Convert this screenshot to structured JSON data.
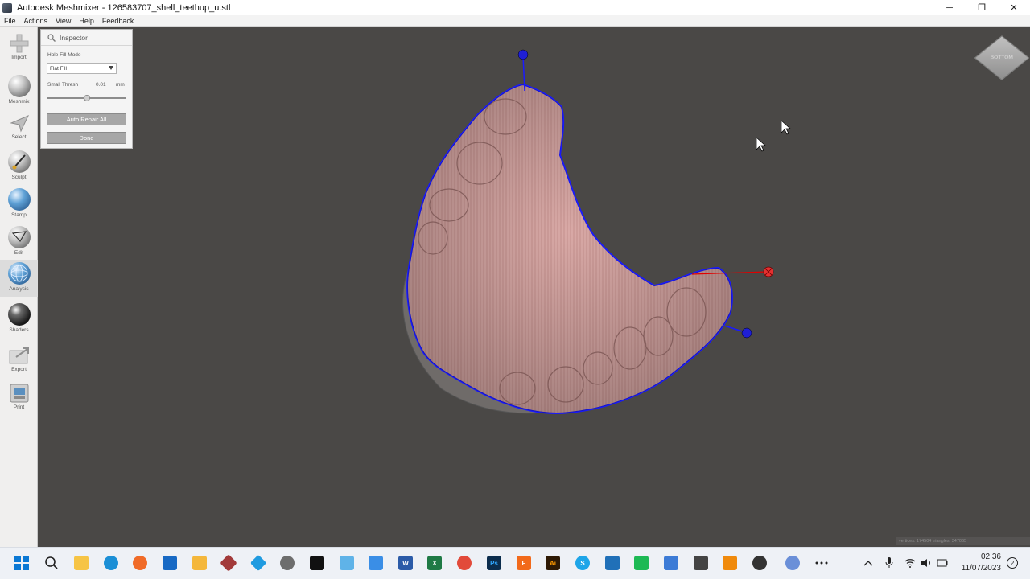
{
  "window": {
    "title": "Autodesk Meshmixer - 126583707_shell_teethup_u.stl",
    "minimize": "─",
    "maximize": "❐",
    "close": "✕"
  },
  "menu": [
    "File",
    "Actions",
    "View",
    "Help",
    "Feedback"
  ],
  "toolbar": {
    "items": [
      {
        "label": "Import",
        "icon": "plus-icon"
      },
      {
        "label": "Meshmix",
        "icon": "meshmix-sphere-icon"
      },
      {
        "label": "Select",
        "icon": "select-arrow-icon"
      },
      {
        "label": "Sculpt",
        "icon": "sculpt-brush-icon"
      },
      {
        "label": "Stamp",
        "icon": "stamp-sphere-icon"
      },
      {
        "label": "Edit",
        "icon": "edit-sphere-icon"
      },
      {
        "label": "Analysis",
        "icon": "analysis-sphere-icon"
      },
      {
        "label": "Shaders",
        "icon": "shader-sphere-icon"
      },
      {
        "label": "Export",
        "icon": "export-icon"
      },
      {
        "label": "Print",
        "icon": "print-icon"
      }
    ],
    "active": "Analysis"
  },
  "inspector": {
    "title": "Inspector",
    "hole_fill_mode_label": "Hole Fill Mode",
    "hole_fill_mode_value": "Flat Fill",
    "small_thresh_label": "Small Thresh",
    "small_thresh_value": "0.01",
    "small_thresh_unit": "mm",
    "small_thresh_slider_fraction": 0.5,
    "auto_repair_label": "Auto Repair All",
    "done_label": "Done"
  },
  "viewport": {
    "view_cube_label": "BOTTOM",
    "stats": "vertices: 174504 triangles: 347065",
    "mesh_color": "#d8a7a4",
    "boundary_color": "#1a1aff"
  },
  "taskbar": {
    "icons": [
      "windows-start-icon",
      "search-icon",
      "file-explorer-icon",
      "edge-icon",
      "firefox-icon",
      "store-icon",
      "folder-icon",
      "meshmixer-icon",
      "app-blue-diamond-icon",
      "settings-icon",
      "app-black-icon",
      "app-image-icon",
      "notepad-icon",
      "word-icon",
      "excel-icon",
      "app-red-swirl-icon",
      "photoshop-icon",
      "fusion360-icon",
      "illustrator-icon",
      "skype-icon",
      "app-cube-icon",
      "app-green-icon",
      "download-icon",
      "media-icon",
      "vlc-icon",
      "chrome-icon",
      "cloud-icon",
      "more-icon"
    ],
    "time": "02:36",
    "date": "11/07/2023",
    "notification_count": "2"
  }
}
